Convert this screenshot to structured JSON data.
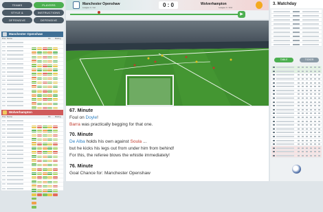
{
  "left_panel": {
    "buttons": [
      {
        "label": "TEAMS",
        "active": false
      },
      {
        "label": "PLAYERS",
        "active": true
      },
      {
        "label": "STYLE & FORMATION",
        "active": false
      },
      {
        "label": "INSTRUCTIONS",
        "active": false
      },
      {
        "label": "OFFENSIVE",
        "active": false
      },
      {
        "label": "DEFENSIVE",
        "active": false
      }
    ],
    "home_team": {
      "name": "Manchester Openshaw",
      "color": "#3f6f95"
    },
    "away_team": {
      "name": "Wolverhampton",
      "color": "#d05a5a"
    },
    "column_headers": {
      "pos": "Pos.",
      "name": "Name",
      "fit": "Fit.",
      "rating": "Rating"
    }
  },
  "header": {
    "home_name": "Manchester Openshaw",
    "home_sub": "League 1 / 1st",
    "away_name": "Wolverhampton",
    "away_sub": "League 1 / 2nd",
    "score": "0 : 0"
  },
  "commentary": [
    {
      "minute": "67. Minute",
      "lines": [
        [
          {
            "t": "Foul on ",
            "c": ""
          },
          {
            "t": "Doyle",
            "c": "blue"
          },
          {
            "t": "!",
            "c": ""
          }
        ],
        [
          {
            "t": "Barra",
            "c": "red"
          },
          {
            "t": " was practically begging for that one.",
            "c": ""
          }
        ]
      ]
    },
    {
      "minute": "70. Minute",
      "lines": [
        [
          {
            "t": "De Alba",
            "c": "blue"
          },
          {
            "t": " holds his own against ",
            "c": ""
          },
          {
            "t": "Soula",
            "c": "red"
          },
          {
            "t": " ...",
            "c": ""
          }
        ],
        [
          {
            "t": "but he kicks his legs out from under him from behind!",
            "c": ""
          }
        ],
        [
          {
            "t": "For this, the referee blows the whistle immediately!",
            "c": ""
          }
        ]
      ]
    },
    {
      "minute": "76. Minute",
      "lines": [
        [
          {
            "t": "Goal Chance for: Manchester Openshaw",
            "c": ""
          }
        ]
      ]
    }
  ],
  "right_panel": {
    "title": "3. Matchday",
    "table_button": "TABLE",
    "ticker_button": "TICKER"
  },
  "colors": {
    "accent": "#4caf50",
    "home": "#3f6f95",
    "away": "#d05a5a",
    "pitch": "#3f8f2f"
  }
}
